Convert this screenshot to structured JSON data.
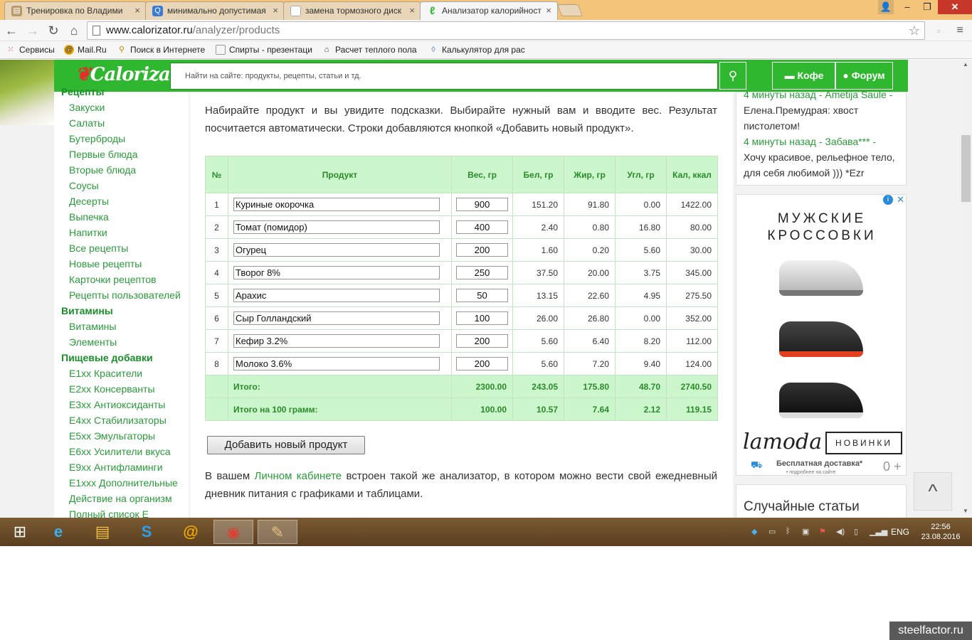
{
  "browser": {
    "tabs": [
      {
        "title": "Тренировка по Владими",
        "icon": "page-icon"
      },
      {
        "title": "минимально допустимая",
        "icon": "search-icon"
      },
      {
        "title": "замена тормозного диск",
        "icon": "page-icon"
      },
      {
        "title": "Анализатор калорийност",
        "icon": "leaf-icon"
      }
    ],
    "url_host": "www.calorizator.ru",
    "url_path": "/analyzer/products",
    "bookmarks": [
      {
        "label": "Сервисы",
        "icon": "apps-icon"
      },
      {
        "label": "Mail.Ru",
        "icon": "mailru-icon"
      },
      {
        "label": "Поиск в Интернете",
        "icon": "search-icon"
      },
      {
        "label": "Спирты - презентаци",
        "icon": "page-icon"
      },
      {
        "label": "Расчет теплого пола",
        "icon": "house-icon"
      },
      {
        "label": "Калькулятор для рас",
        "icon": "drop-icon"
      }
    ]
  },
  "site": {
    "logo_text": "Calorizator",
    "search_placeholder": "Найти на сайте: продукты, рецепты, статьи и тд.",
    "coffee_label": "Кофе",
    "forum_label": "Форум"
  },
  "sidebar": {
    "recipes_header": "Рецепты",
    "recipes": [
      "Закуски",
      "Салаты",
      "Бутерброды",
      "Первые блюда",
      "Вторые блюда",
      "Соусы",
      "Десерты",
      "Выпечка",
      "Напитки",
      "Все рецепты",
      "Новые рецепты",
      "Карточки рецептов",
      "Рецепты пользователей"
    ],
    "vitamins_header": "Витамины",
    "vitamins": [
      "Витамины",
      "Элементы"
    ],
    "additives_header": "Пищевые добавки",
    "additives": [
      "E1xx Красители",
      "E2xx Консерванты",
      "E3xx Антиоксиданты",
      "E4xx Стабилизаторы",
      "E5xx Эмульгаторы",
      "E6xx Усилители вкуса",
      "E9xx Антифламинги",
      "E1xxx Дополнительные",
      "Действие на организм",
      "Полный список E"
    ]
  },
  "main": {
    "intro": "Набирайте продукт и вы увидите подсказки. Выбирайте нужный вам и вводите вес. Результат посчитается автоматически. Строки добавляются кнопкой «Добавить новый продукт».",
    "headers": {
      "n": "№",
      "product": "Продукт",
      "weight": "Вес, гр",
      "protein": "Бел, гр",
      "fat": "Жир, гр",
      "carb": "Угл, гр",
      "kcal": "Кал, ккал"
    },
    "rows": [
      {
        "n": "1",
        "product": "Куриные окорочка",
        "weight": "900",
        "protein": "151.20",
        "fat": "91.80",
        "carb": "0.00",
        "kcal": "1422.00"
      },
      {
        "n": "2",
        "product": "Томат (помидор)",
        "weight": "400",
        "protein": "2.40",
        "fat": "0.80",
        "carb": "16.80",
        "kcal": "80.00"
      },
      {
        "n": "3",
        "product": "Огурец",
        "weight": "200",
        "protein": "1.60",
        "fat": "0.20",
        "carb": "5.60",
        "kcal": "30.00"
      },
      {
        "n": "4",
        "product": "Творог 8%",
        "weight": "250",
        "protein": "37.50",
        "fat": "20.00",
        "carb": "3.75",
        "kcal": "345.00"
      },
      {
        "n": "5",
        "product": "Арахис",
        "weight": "50",
        "protein": "13.15",
        "fat": "22.60",
        "carb": "4.95",
        "kcal": "275.50"
      },
      {
        "n": "6",
        "product": "Сыр Голландский",
        "weight": "100",
        "protein": "26.00",
        "fat": "26.80",
        "carb": "0.00",
        "kcal": "352.00"
      },
      {
        "n": "7",
        "product": "Кефир 3.2%",
        "weight": "200",
        "protein": "5.60",
        "fat": "6.40",
        "carb": "8.20",
        "kcal": "112.00"
      },
      {
        "n": "8",
        "product": "Молоко 3.6%",
        "weight": "200",
        "protein": "5.60",
        "fat": "7.20",
        "carb": "9.40",
        "kcal": "124.00"
      }
    ],
    "total": {
      "label": "Итого:",
      "weight": "2300.00",
      "protein": "243.05",
      "fat": "175.80",
      "carb": "48.70",
      "kcal": "2740.50"
    },
    "per100": {
      "label": "Итого на 100 грамм:",
      "weight": "100.00",
      "protein": "10.57",
      "fat": "7.64",
      "carb": "2.12",
      "kcal": "119.15"
    },
    "add_button": "Добавить новый продукт",
    "outro_before": "В вашем",
    "outro_link": "Личном кабинете",
    "outro_after": "встроен такой же анализатор, в котором можно вести свой ежедневный дневник питания с графиками и таблицами."
  },
  "feed": {
    "items": [
      {
        "author": "4 минуты назад - Ametija Saule -",
        "text": "Елена.Премудрая: хвост пистолетом!"
      },
      {
        "author": "4 минуты назад - Забава*** -",
        "text": "Хочу красивое, рельефное тело, для себя любимой ))) *Ezr"
      }
    ]
  },
  "ad": {
    "title": "МУЖСКИЕ КРОССОВКИ",
    "brand": "lamoda",
    "new_label": "НОВИНКИ",
    "delivery": "Бесплатная доставка*",
    "delivery_note": "• подробнее на сайте",
    "likes": "0 +"
  },
  "random_articles": "Случайные статьи",
  "taskbar": {
    "lang": "ENG",
    "time": "22:56",
    "date": "23.08.2016"
  },
  "watermark": "steelfactor.ru",
  "colors": {
    "site_green": "#2fb72f",
    "link_green": "#2a9a3a",
    "table_head": "#ccf7cc",
    "tabstrip": "#f3c47a"
  }
}
